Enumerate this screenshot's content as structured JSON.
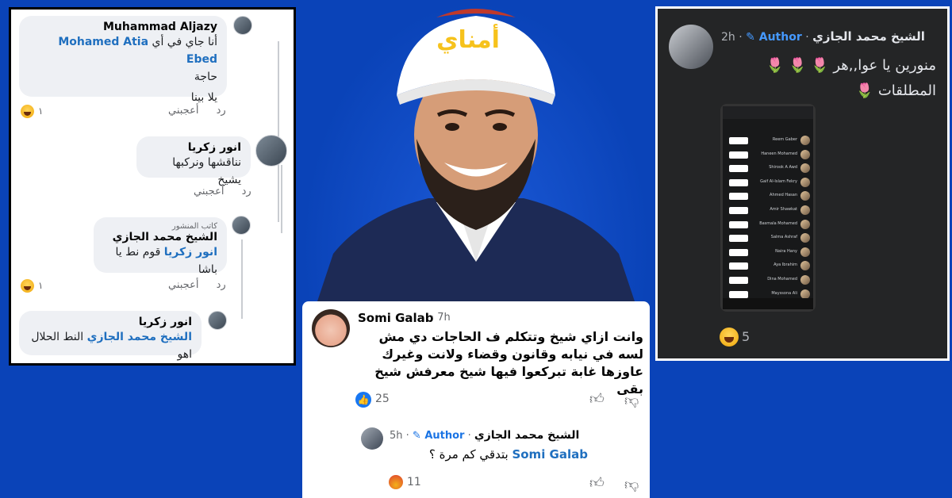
{
  "left_panel": {
    "comment1": {
      "name": "Muhammad Aljazy",
      "line1": "أنا جاي في أي",
      "mention": "Mohamed Atia Ebed",
      "line2": "حاجة",
      "line3": "يلا بينا",
      "actions": [
        "أعجبني",
        "رد"
      ],
      "reaction_count": "١"
    },
    "comment2": {
      "name": "انور زكريا",
      "text": "نناقشها ونركبها يشيخ",
      "actions": [
        "أعجبني",
        "رد"
      ]
    },
    "comment3": {
      "author_tag": "كاتب المنشور",
      "name": "الشيخ محمد الجازي",
      "mention": "انور زكريا",
      "text": "قوم نط يا باشا",
      "actions": [
        "أعجبني",
        "رد"
      ],
      "reaction_count": "١"
    },
    "comment4": {
      "name": "انور زكريا",
      "mention": "الشيخ محمد الجازي",
      "text": "النط الحلال اهو"
    }
  },
  "center": {
    "logo_text": "أمناي",
    "card": {
      "name": "Somi Galab",
      "time": "· 7h",
      "text": "وانت ازاي شيخ وتتكلم ف الحاجات دي مش لسه في نيابه وقانون وقضاء ولانت وغيرك عاوزها غابة تبركعوا فيها شيخ معرفش شيخ بقى",
      "like_count": "25",
      "reply": {
        "time": "5h ·",
        "author_label": "Author",
        "name": "الشيخ محمد الجازي",
        "mention": "Somi Galab",
        "text": "بتدقي كم مرة ؟",
        "angry_count": "11"
      }
    }
  },
  "right_panel": {
    "time": "2h ·",
    "author_label": "Author",
    "name": "الشيخ محمد الجازي",
    "line1": "منورين يا عوا,,هر",
    "line2": "المطلقات",
    "tulip": "🌷",
    "phone": {
      "rows": [
        "Reem Gaber",
        "Haneen Mohamed",
        "Shirook A Awd",
        "Gaif Al-Islam Fekry",
        "Ahmed Hasan",
        "Amir Shawkat",
        "Basmala Mohamed",
        "Salma Ashraf",
        "Naira Hany",
        "Aya Ibrahim",
        "Dina Mohamed",
        "Mayssona Ali"
      ],
      "button_label": "Mute"
    },
    "reaction_count": "5"
  },
  "colors": {
    "background": "#0a43b8",
    "mention": "#1f6fbf",
    "author_blue": "#1b74e4",
    "dark_panel": "#242526"
  }
}
